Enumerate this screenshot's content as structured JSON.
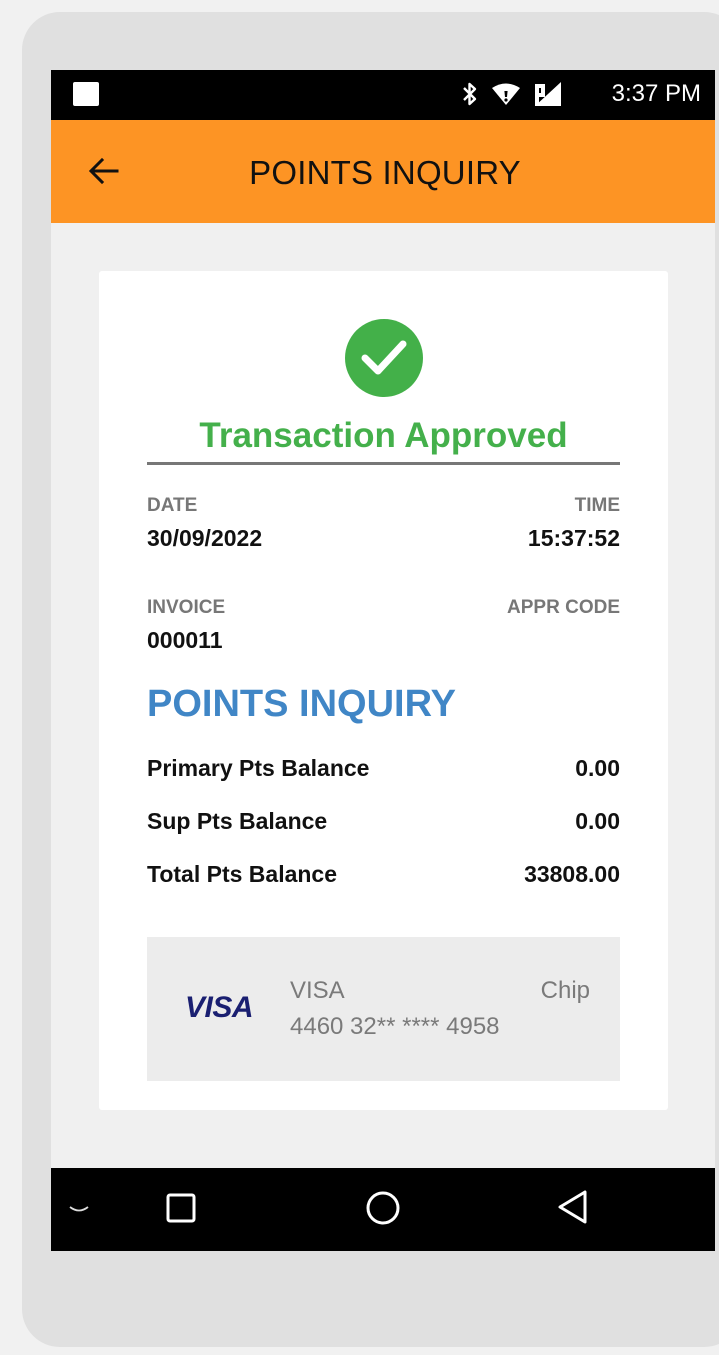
{
  "status_bar": {
    "time": "3:37 PM",
    "icons": [
      "notification-square-icon",
      "bluetooth-icon",
      "wifi-icon",
      "signal-icon"
    ]
  },
  "app_bar": {
    "title": "POINTS INQUIRY",
    "back_icon": "back-arrow-icon"
  },
  "receipt": {
    "status_icon": "check-circle-icon",
    "status_text": "Transaction Approved",
    "date_label": "DATE",
    "date_value": "30/09/2022",
    "time_label": "TIME",
    "time_value": "15:37:52",
    "invoice_label": "INVOICE",
    "invoice_value": "000011",
    "appr_code_label": "APPR CODE",
    "appr_code_value": "",
    "section_title": "POINTS INQUIRY",
    "balances": [
      {
        "label": "Primary Pts Balance",
        "value": "0.00"
      },
      {
        "label": "Sup Pts Balance",
        "value": "0.00"
      },
      {
        "label": "Total Pts Balance",
        "value": "33808.00"
      }
    ],
    "card": {
      "logo_text": "VISA",
      "type": "VISA",
      "entry_mode": "Chip",
      "number": "4460 32** **** 4958"
    }
  },
  "colors": {
    "app_bar": "#fd9424",
    "approved_green": "#44b04b",
    "section_blue": "#4086c6",
    "visa_navy": "#1a1f71"
  },
  "nav_bar": {
    "icons": [
      "keyboard-hide-icon",
      "recents-square-icon",
      "home-circle-icon",
      "back-triangle-icon"
    ]
  }
}
